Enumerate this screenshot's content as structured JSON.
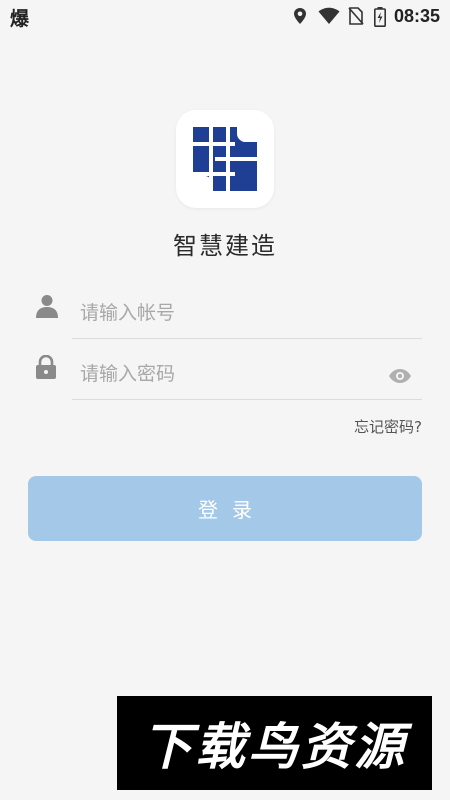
{
  "status_bar": {
    "left_char": "爆",
    "time": "08:35",
    "icons": [
      "location-icon",
      "wifi-icon",
      "no-sim-icon",
      "battery-charging-icon"
    ]
  },
  "app": {
    "logo_icon": "app-logo-s-icon",
    "title": "智慧建造",
    "brand_color": "#1e3f93"
  },
  "login_form": {
    "account_placeholder": "请输入帐号",
    "password_placeholder": "请输入密码",
    "account_icon": "user-icon",
    "password_icon": "lock-icon",
    "toggle_icon": "eye-icon",
    "forgot_label": "忘记密码?",
    "submit_label": "登录",
    "submit_color": "#a4c8e8"
  },
  "watermark": {
    "text": "下载鸟资源"
  }
}
